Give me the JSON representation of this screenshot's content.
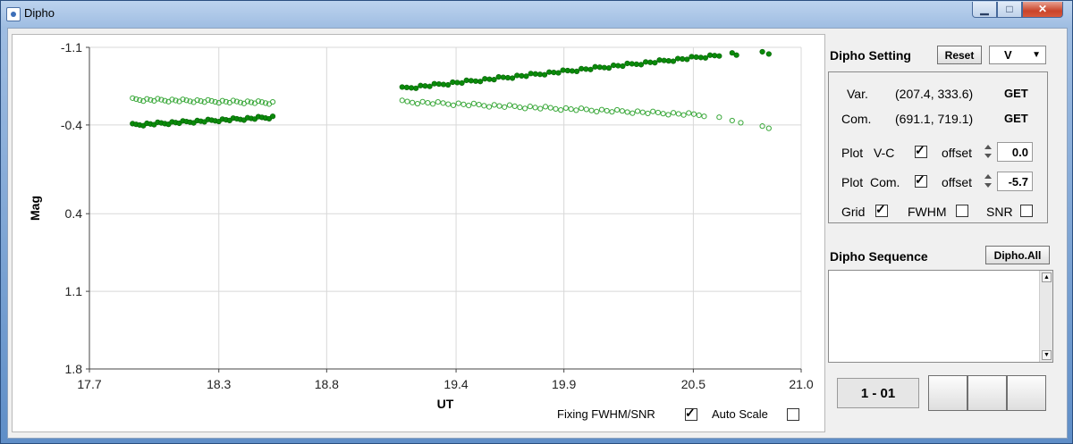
{
  "window": {
    "title": "Dipho",
    "icon": "app-icon"
  },
  "plot": {
    "xlabel": "UT",
    "ylabel": "Mag",
    "fixing_label": "Fixing FWHM/SNR",
    "fixing_checked": true,
    "autoscale_label": "Auto Scale",
    "autoscale_checked": false
  },
  "chart_data": {
    "type": "scatter",
    "title": "",
    "xlabel": "UT",
    "ylabel": "Mag",
    "xlim": [
      17.7,
      21.0
    ],
    "ylim": [
      -1.1,
      1.8
    ],
    "y_inverted": true,
    "x_ticks": [
      "17.7",
      "18.3",
      "18.8",
      "19.4",
      "19.9",
      "20.5",
      "21.0"
    ],
    "y_ticks": [
      "-1.1",
      "-0.4",
      "0.4",
      "1.1",
      "1.8"
    ],
    "grid": true,
    "colors": {
      "vc": "#0a8a0a",
      "com": "#3aa83a"
    },
    "series": [
      {
        "values": [
          {
            "segment": [
              17.9,
              18.55
            ],
            "y": [
              -0.4,
              -0.47
            ],
            "n": 40
          },
          {
            "segment": [
              19.15,
              20.62
            ],
            "y": [
              -0.73,
              -1.03
            ],
            "n": 70
          },
          {
            "points": [
              [
                20.68,
                -1.05
              ],
              [
                20.7,
                -1.03
              ],
              [
                20.82,
                -1.06
              ],
              [
                20.85,
                -1.04
              ]
            ]
          }
        ]
      },
      {
        "values": [
          {
            "segment": [
              17.9,
              18.55
            ],
            "y": [
              -0.63,
              -0.6
            ],
            "n": 40
          },
          {
            "segment": [
              19.15,
              20.55
            ],
            "y": [
              -0.61,
              -0.49
            ],
            "n": 60
          },
          {
            "points": [
              [
                20.62,
                -0.47
              ],
              [
                20.68,
                -0.44
              ],
              [
                20.72,
                -0.42
              ],
              [
                20.82,
                -0.39
              ],
              [
                20.85,
                -0.37
              ]
            ]
          }
        ]
      }
    ]
  },
  "settings": {
    "title": "Dipho Setting",
    "reset_label": "Reset",
    "filter_value": "V",
    "var_label": "Var.",
    "var_coords": "(207.4, 333.6)",
    "var_get": "GET",
    "com_label": "Com.",
    "com_coords": "(691.1, 719.1)",
    "com_get": "GET",
    "plot_vc_label": "Plot",
    "plot_vc_name": "V-C",
    "plot_vc_checked": true,
    "offset_label": "offset",
    "plot_vc_offset": "0.0",
    "plot_com_label": "Plot",
    "plot_com_name": "Com.",
    "plot_com_checked": true,
    "plot_com_offset": "-5.7",
    "grid_label": "Grid",
    "grid_checked": true,
    "fwhm_label": "FWHM",
    "fwhm_checked": false,
    "snr_label": "SNR",
    "snr_checked": false
  },
  "sequence": {
    "title": "Dipho Sequence",
    "all_label": "Dipho.All",
    "counter": "1 - 01"
  }
}
